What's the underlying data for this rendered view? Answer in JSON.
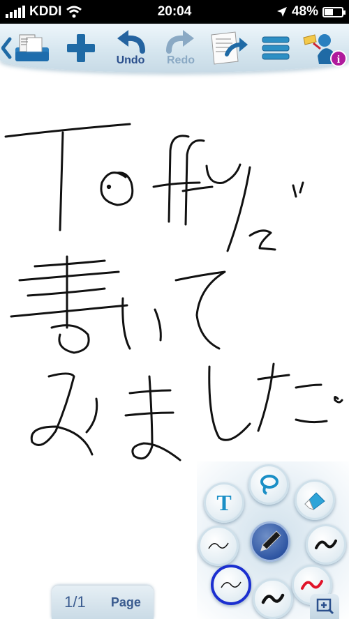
{
  "status_bar": {
    "carrier": "KDDI",
    "time": "20:04",
    "battery_text": "48%",
    "battery_level": 0.48,
    "icons": [
      "signal-icon",
      "wifi-icon",
      "location-arrow-icon",
      "battery-icon"
    ]
  },
  "toolbar": {
    "buttons": [
      {
        "name": "back-notebooks",
        "icon": "notebook-folder-icon",
        "label": ""
      },
      {
        "name": "add-page",
        "icon": "plus-icon",
        "label": ""
      },
      {
        "name": "undo",
        "icon": "undo-arrow-icon",
        "label": "Undo"
      },
      {
        "name": "redo",
        "icon": "redo-arrow-icon",
        "label": "Redo",
        "disabled": true
      },
      {
        "name": "share",
        "icon": "share-note-icon",
        "label": ""
      },
      {
        "name": "menu",
        "icon": "list-menu-icon",
        "label": ""
      },
      {
        "name": "info",
        "icon": "info-character-icon",
        "label": ""
      }
    ]
  },
  "canvas": {
    "content": "handwritten-note",
    "ink_color": "#111111"
  },
  "palette": {
    "tools": [
      "text-tool-icon",
      "lasso-tool-icon",
      "eraser-tool-icon",
      "pen-tool-icon"
    ],
    "pens": [
      {
        "name": "thin-black",
        "color": "#111111",
        "selected": true
      },
      {
        "name": "thin-black-2",
        "color": "#111111"
      },
      {
        "name": "thick-black",
        "color": "#111111"
      },
      {
        "name": "black",
        "color": "#111111"
      },
      {
        "name": "red",
        "color": "#e0142a"
      }
    ]
  },
  "page_indicator": {
    "current": "1/1",
    "label": "Page"
  },
  "colors": {
    "toolbar_blue": "#1f6aa5",
    "label_blue": "#2a4f8c",
    "disabled": "#8aa9c4",
    "accent_select": "#1b2fd0"
  }
}
